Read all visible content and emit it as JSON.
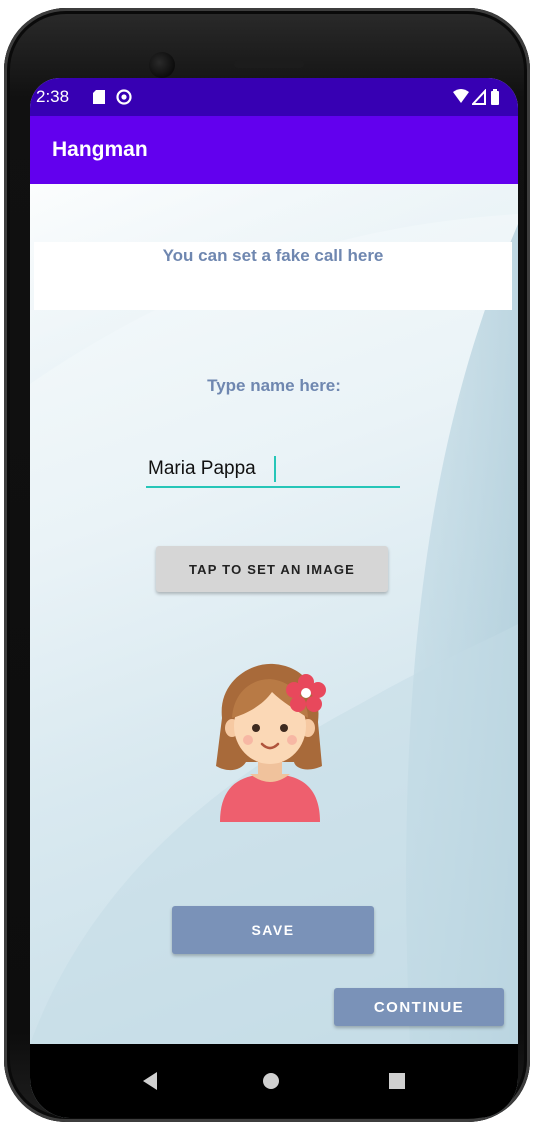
{
  "status_bar": {
    "time": "2:38",
    "icons": [
      "sd-card-icon",
      "notification-icon",
      "wifi-icon",
      "signal-icon",
      "battery-icon"
    ]
  },
  "app_bar": {
    "title": "Hangman"
  },
  "main": {
    "banner_text": "You can set a fake call here",
    "name_label": "Type name here:",
    "name_input_value": "Maria Pappa",
    "set_image_button": "TAP TO SET AN IMAGE",
    "save_button": "SAVE",
    "continue_button": "CONTINUE"
  },
  "navigation": {
    "buttons": [
      "back-icon",
      "home-icon",
      "recents-icon"
    ]
  },
  "colors": {
    "status_bar": "#3700b3",
    "app_bar": "#6200ee",
    "accent_text": "#6f87b0",
    "button_primary": "#7a92b8",
    "input_underline": "#26c6b8"
  }
}
